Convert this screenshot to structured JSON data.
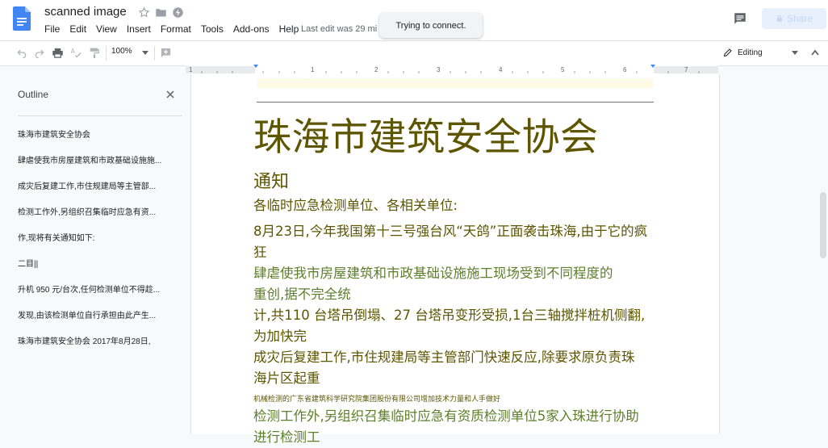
{
  "app": {
    "doc_title": "scanned image",
    "last_edit": "Last edit was 29 mi",
    "toast": "Trying to connect.",
    "share_label": "Share",
    "menu": [
      "File",
      "Edit",
      "View",
      "Insert",
      "Format",
      "Tools",
      "Add-ons",
      "Help"
    ]
  },
  "toolbar": {
    "zoom": "100%",
    "mode": "Editing",
    "icons": [
      "undo-icon",
      "redo-icon",
      "print-icon",
      "spellcheck-icon",
      "paint-format-icon",
      "comment-add-icon"
    ]
  },
  "ruler": {
    "marks": [
      "1",
      "1",
      "2",
      "3",
      "4",
      "5",
      "6",
      "7"
    ]
  },
  "outline": {
    "title": "Outline",
    "items": [
      "珠海市建筑安全协会",
      "肆虐使我市房屋建筑和市政基础设施施...",
      "成灾后复建工作,市住规建局等主管部...",
      "检测工作外,另组织召集临时应急有资...",
      "作,现将有关通知如下:",
      "二目||",
      "升机 950 元/台次,任何检测单位不得趁...",
      "发现,由该检测单位自行承担由此产生...",
      "珠海市建筑安全协会 2017年8月28日,"
    ]
  },
  "document": {
    "title": "珠海市建筑安全协会",
    "heading": "通知",
    "p1": "各临时应急检测单位、各相关单位:",
    "p2": "8月23日,今年我国第十三号强台风“天鸽”正面袭击珠海,由于它的疯\n狂",
    "p3": "肆虐使我市房屋建筑和市政基础设施施工现场受到不同程度的\n重创,据不完全统",
    "p4": "计,共110 台塔吊倒塌、27 台塔吊变形受损,1台三轴搅拌桩机侧翻,\n为加快完",
    "p5": "成灾后复建工作,市住规建局等主管部门快速反应,除要求原负责珠\n海片区起重",
    "small": "机械检测的广东省建筑科学研究院集团股份有限公司增加技术力量和人手做好",
    "p6": "检测工作外,另组织召集临时应急有资质检测单位5家入珠进行协助\n进行检测工"
  },
  "colors": {
    "title_olive": "#5d5500",
    "text_green": "#5d7e2a",
    "docs_blue": "#4285f4"
  }
}
